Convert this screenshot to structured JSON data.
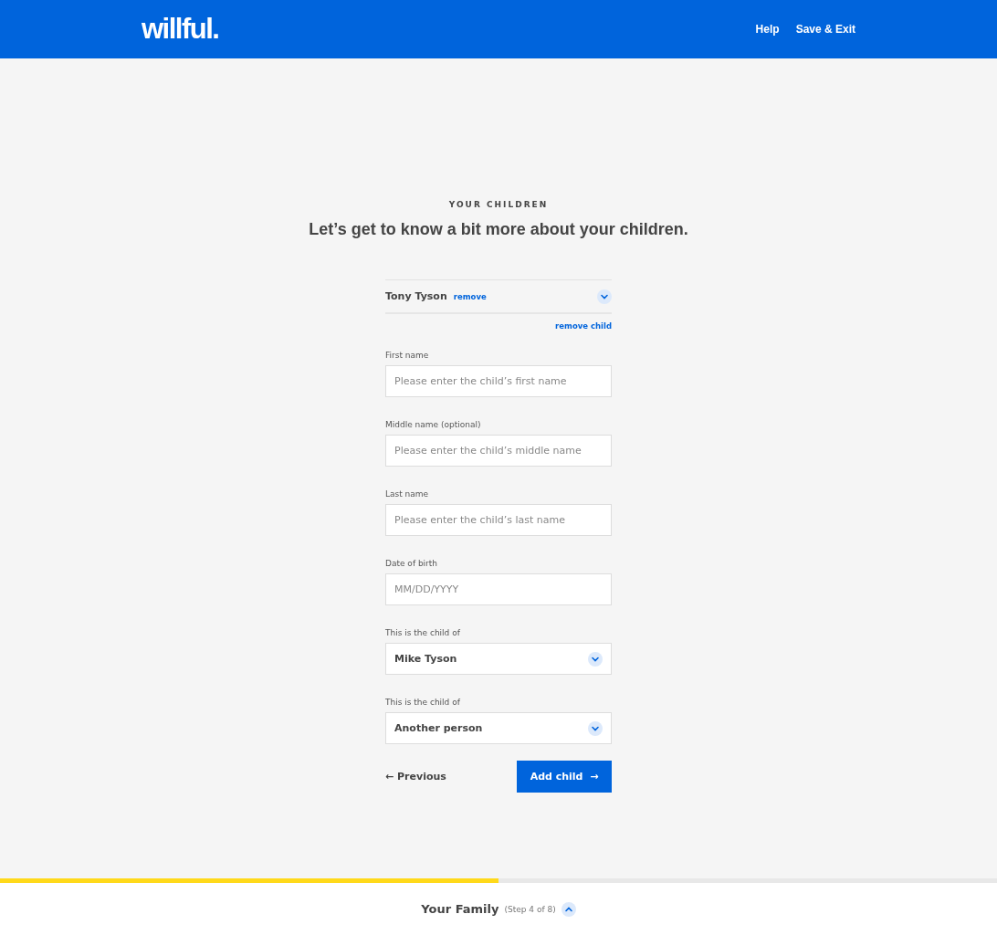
{
  "header": {
    "logo": "willful.",
    "nav": [
      "Help",
      "Save & Exit"
    ]
  },
  "eyebrow": "YOUR CHILDREN",
  "heading": "Let’s get to know a bit more about your children.",
  "child": {
    "name": "Tony Tyson",
    "remove": "remove",
    "expanded": true,
    "remove_child": "remove child"
  },
  "fields": [
    {
      "kind": "text",
      "label": "First name",
      "placeholder": "Please enter the child’s first name"
    },
    {
      "kind": "text",
      "label": "Middle name (optional)",
      "placeholder": "Please enter the child’s middle name"
    },
    {
      "kind": "text",
      "label": "Last name",
      "placeholder": "Please enter the child’s last name"
    },
    {
      "kind": "text",
      "label": "Date of birth",
      "placeholder": "MM/DD/YYYY"
    },
    {
      "kind": "select",
      "label": "This is the child of",
      "value": "Mike Tyson"
    },
    {
      "kind": "select",
      "label": "This is the child of",
      "value": "Another person"
    }
  ],
  "previous": {
    "arrow": "←",
    "label": "Previous"
  },
  "add": {
    "label": "Add child",
    "arrow": "→"
  },
  "progress": {
    "level": 0.5
  },
  "footer": {
    "section": "Your Family",
    "step": "(Step 4 of 8)",
    "expanded": true
  }
}
